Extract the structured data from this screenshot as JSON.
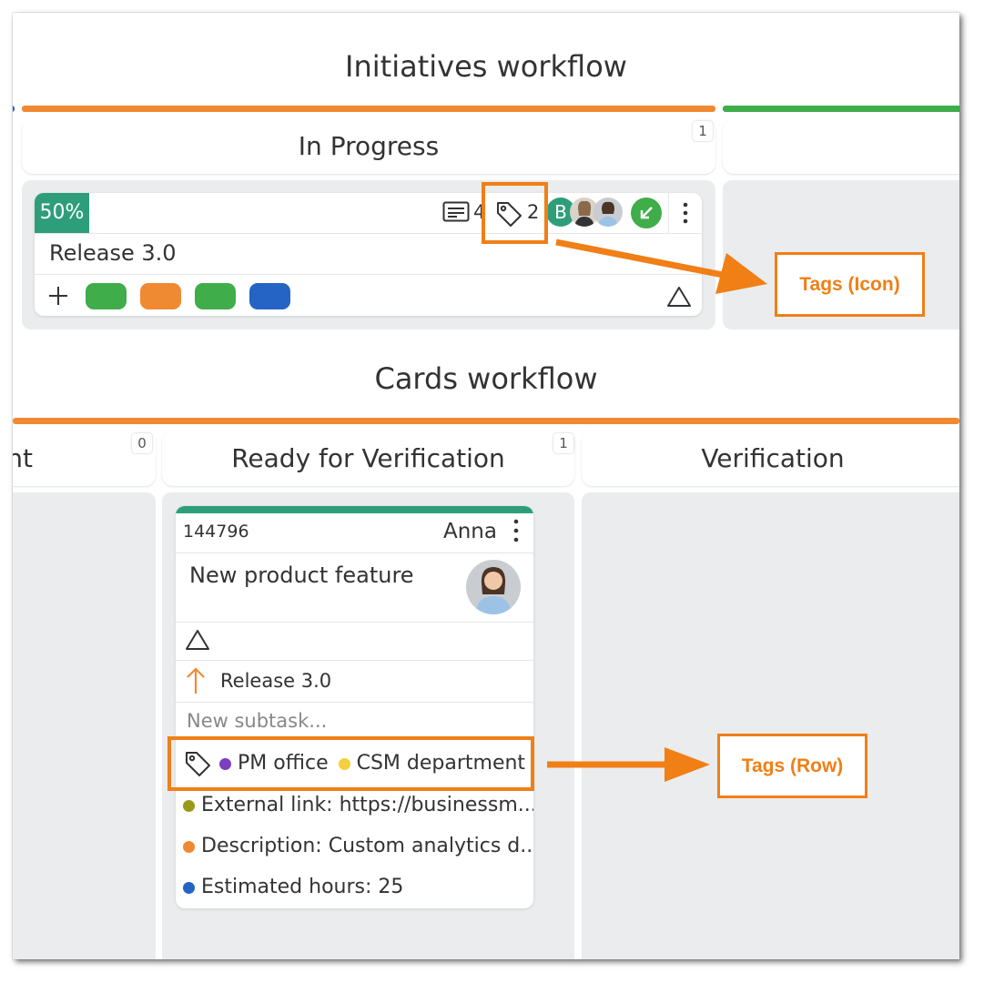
{
  "initiatives": {
    "title": "Initiatives workflow",
    "in_progress": {
      "label": "In Progress",
      "count": "1"
    },
    "card": {
      "percent": "50%",
      "comments_count": "4",
      "tags_count": "2",
      "avatar_letter": "B",
      "title": "Release 3.0"
    }
  },
  "cards": {
    "title": "Cards workflow",
    "left_col": {
      "label": "nt",
      "count": "0"
    },
    "ready": {
      "label": "Ready for Verification",
      "count": "1"
    },
    "verification": {
      "label": "Verification"
    },
    "card": {
      "id": "144796",
      "owner": "Anna",
      "title": "New product feature",
      "parent": "Release 3.0",
      "subtask_placeholder": "New subtask...",
      "tags": [
        {
          "label": "PM office",
          "color": "#7b3fbf"
        },
        {
          "label": "CSM department",
          "color": "#f4d03f"
        }
      ],
      "fields": [
        {
          "text": "External link: https://businessm...",
          "color": "#9a9a1a"
        },
        {
          "text": "Description: Custom analytics d...",
          "color": "#f08a32"
        },
        {
          "text": "Estimated hours: 25",
          "color": "#2563c4"
        }
      ]
    }
  },
  "callouts": {
    "icon": "Tags (Icon)",
    "row": "Tags (Row)"
  },
  "colors": {
    "orange": "#f08a32",
    "green": "#3fad4a",
    "teal": "#2e9e7a",
    "blue": "#2563c4",
    "callout_orange": "#f07f16"
  }
}
